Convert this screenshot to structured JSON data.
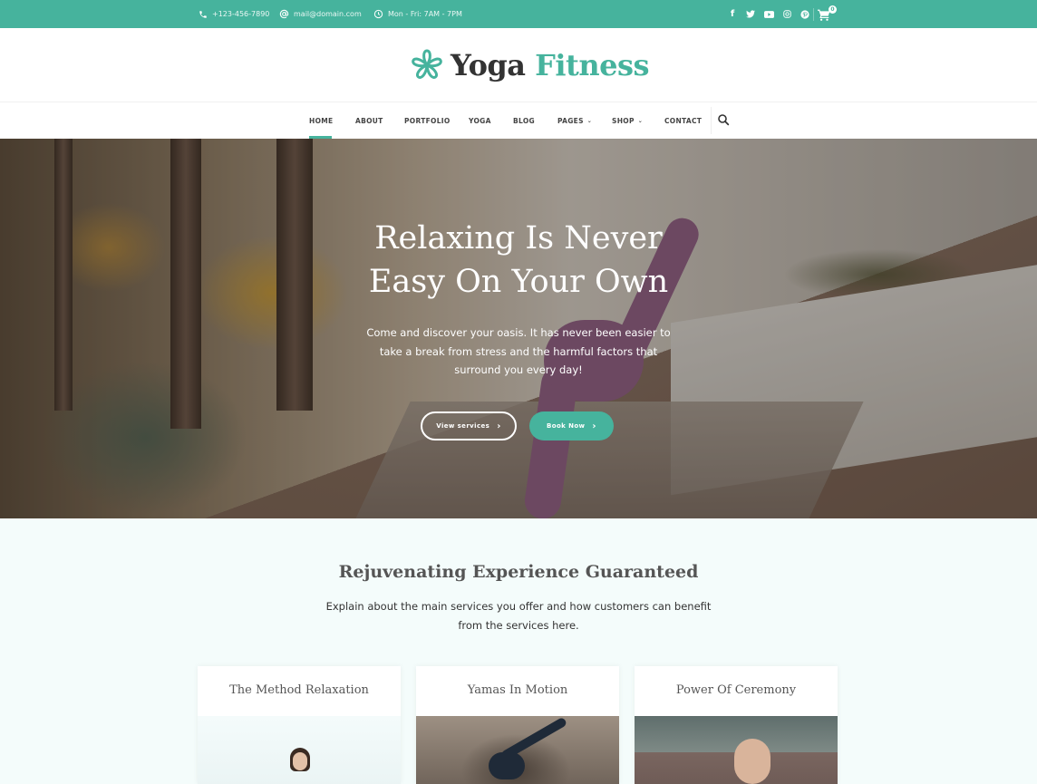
{
  "topbar": {
    "phone": "+123-456-7890",
    "email": "mail@domain.com",
    "hours": "Mon - Fri: 7AM - 7PM",
    "social": [
      {
        "name": "facebook-icon",
        "glyph": "f"
      },
      {
        "name": "twitter-icon",
        "glyph": "t"
      },
      {
        "name": "youtube-icon",
        "glyph": "▶"
      },
      {
        "name": "instagram-icon",
        "glyph": "◎"
      },
      {
        "name": "pinterest-icon",
        "glyph": "p"
      }
    ],
    "cart_count": "0"
  },
  "logo": {
    "part1": "Yoga",
    "part2": "Fitness",
    "accent_color": "#46b39d"
  },
  "nav": {
    "items": [
      {
        "label": "HOME",
        "active": true
      },
      {
        "label": "ABOUT"
      },
      {
        "label": "PORTFOLIO"
      },
      {
        "label": "YOGA"
      },
      {
        "label": "BLOG"
      },
      {
        "label": "PAGES",
        "dropdown": true
      },
      {
        "label": "SHOP",
        "dropdown": true
      },
      {
        "label": "CONTACT"
      }
    ],
    "search_icon": "search-icon"
  },
  "hero": {
    "title_line1": "Relaxing Is Never",
    "title_line2": "Easy On Your Own",
    "text": "Come and discover your oasis. It has never been easier to take a break from stress and the harmful factors that surround you every day!",
    "btn_services": "View services",
    "btn_book": "Book Now",
    "arrow": "›"
  },
  "services": {
    "title": "Rejuvenating Experience Guaranteed",
    "text": "Explain about the main services you offer and how customers can benefit from the services here.",
    "cards": [
      {
        "title": "The Method Relaxation"
      },
      {
        "title": "Yamas In Motion"
      },
      {
        "title": "Power Of Ceremony"
      }
    ]
  }
}
